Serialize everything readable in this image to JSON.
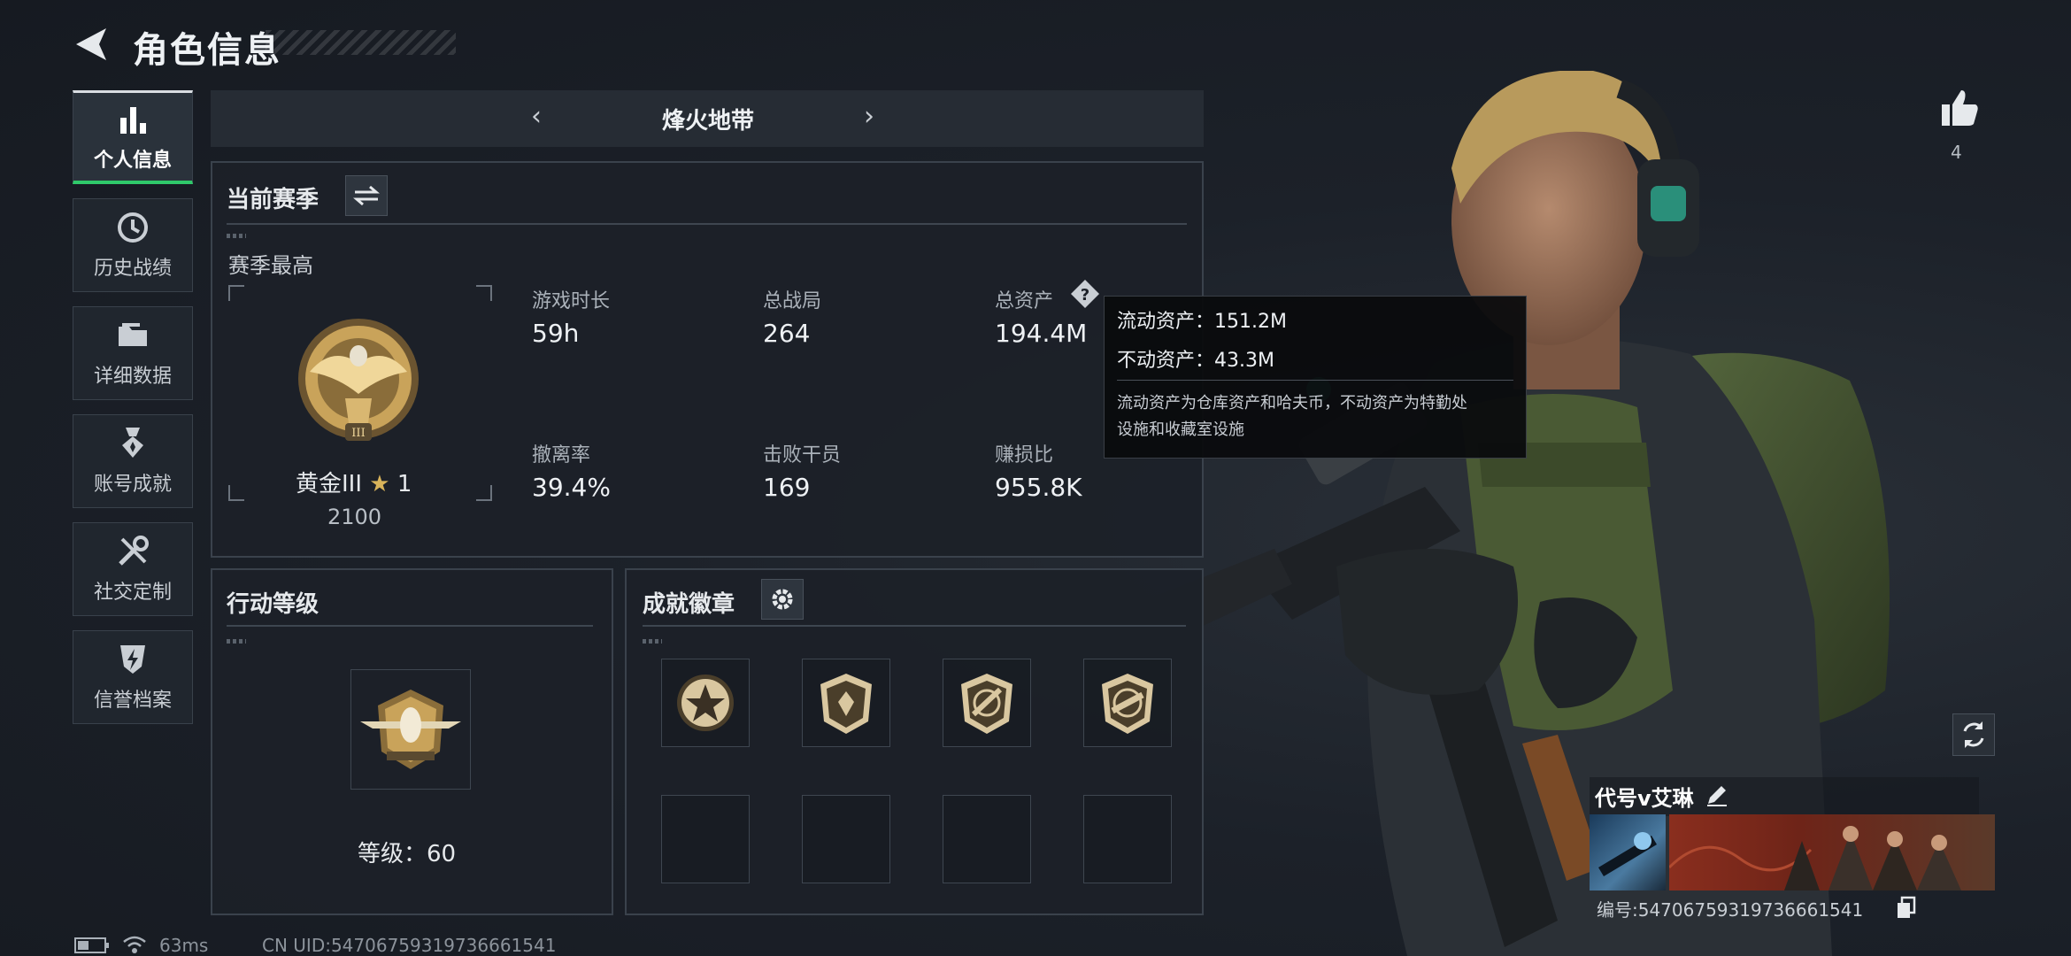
{
  "header": {
    "title": "角色信息",
    "back_icon": "arrow-left-icon"
  },
  "sidebar": {
    "items": [
      {
        "label": "个人信息",
        "icon": "bar-chart-icon",
        "active": true
      },
      {
        "label": "历史战绩",
        "icon": "history-clock-icon",
        "active": false
      },
      {
        "label": "详细数据",
        "icon": "folder-icon",
        "active": false
      },
      {
        "label": "账号成就",
        "icon": "medal-icon",
        "active": false
      },
      {
        "label": "社交定制",
        "icon": "tools-icon",
        "active": false
      },
      {
        "label": "信誉档案",
        "icon": "shield-bolt-icon",
        "active": false
      }
    ]
  },
  "mode": {
    "title": "烽火地带"
  },
  "season": {
    "title": "当前赛季",
    "best_label": "赛季最高",
    "rank_name": "黄金III",
    "rank_stars": "1",
    "rank_score": "2100",
    "stats": [
      {
        "label": "游戏时长",
        "value": "59h"
      },
      {
        "label": "总战局",
        "value": "264"
      },
      {
        "label": "总资产",
        "value": "194.4M"
      },
      {
        "label": "撤离率",
        "value": "39.4%"
      },
      {
        "label": "击败干员",
        "value": "169"
      },
      {
        "label": "赚损比",
        "value": "955.8K"
      }
    ]
  },
  "tooltip": {
    "liquid": "流动资产：151.2M",
    "fixed": "不动资产：43.3M",
    "note_line1": "流动资产为仓库资产和哈夫币，不动资产为特勤处",
    "note_line2": "设施和收藏室设施"
  },
  "action_level": {
    "title": "行动等级",
    "level_text": "等级：60"
  },
  "badges": {
    "title": "成就徽章"
  },
  "likes": {
    "count": "4"
  },
  "profile": {
    "name": "代号v艾琳",
    "id_text": "编号:5470675931973666154​1"
  },
  "footer": {
    "ping": "63ms",
    "uid": "CN UID:547067593197366615​41"
  },
  "colors": {
    "accent_green": "#2fc96a",
    "gold": "#c9a35a",
    "panel_border": "#3a424c"
  }
}
